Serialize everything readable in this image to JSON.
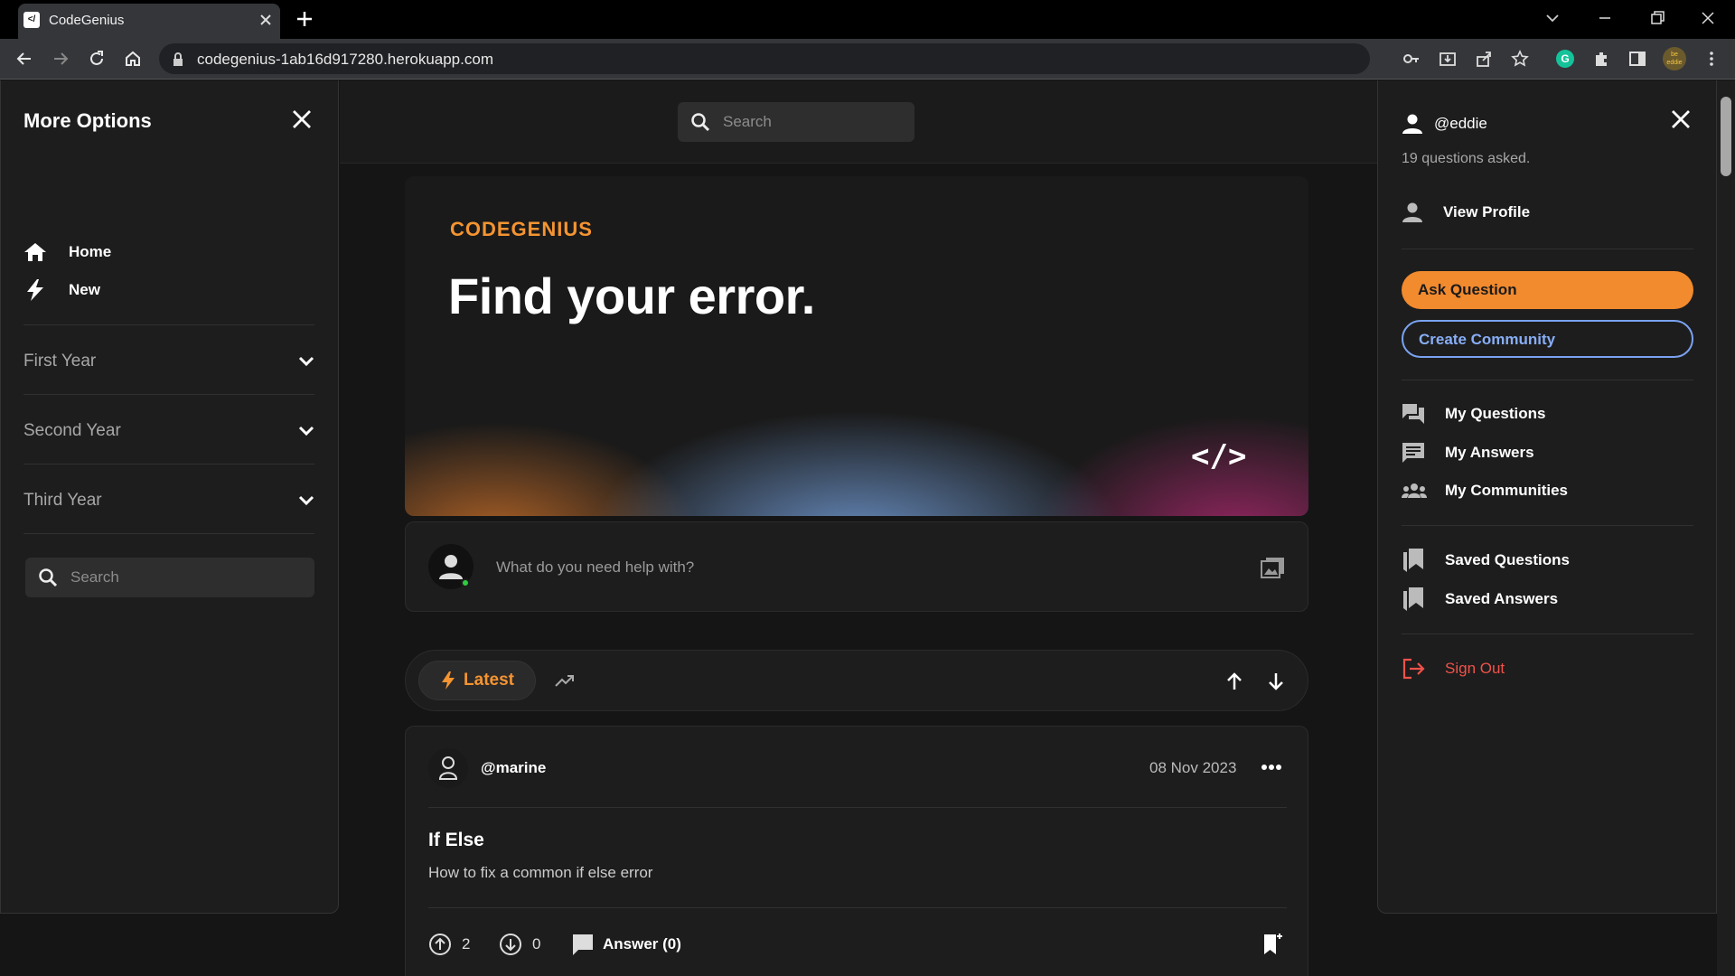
{
  "browser": {
    "tab_title": "CodeGenius",
    "favicon_text": "</",
    "url": "codegenius-1ab16d917280.herokuapp.com",
    "extension_badge": "G",
    "profile_text": "be eddie"
  },
  "left_panel": {
    "title": "More Options",
    "nav": [
      {
        "label": "Home",
        "icon": "home-icon"
      },
      {
        "label": "New",
        "icon": "bolt-icon"
      }
    ],
    "years": [
      "First Year",
      "Second Year",
      "Third Year"
    ],
    "search_placeholder": "Search"
  },
  "header": {
    "search_placeholder": "Search"
  },
  "hero": {
    "brand": "CODEGENIUS",
    "headline": "Find your error.",
    "code_glyph": "</>"
  },
  "composer": {
    "placeholder": "What do you need help with?"
  },
  "sort_bar": {
    "latest_label": "Latest"
  },
  "post": {
    "author": "@marine",
    "date": "08 Nov 2023",
    "title": "If Else",
    "body": "How to fix a common if else error",
    "upvotes": "2",
    "downvotes": "0",
    "answer_label": "Answer (0)"
  },
  "right_panel": {
    "username": "@eddie",
    "questions_asked": "19 questions asked.",
    "view_profile": "View Profile",
    "ask_question": "Ask Question",
    "create_community": "Create Community",
    "my_questions": "My Questions",
    "my_answers": "My Answers",
    "my_communities": "My Communities",
    "saved_questions": "Saved Questions",
    "saved_answers": "Saved Answers",
    "sign_out": "Sign Out"
  },
  "colors": {
    "accent_orange": "#f28a2e",
    "accent_blue": "#7aa2f0",
    "danger": "#f0524a",
    "online": "#2ecc40"
  }
}
